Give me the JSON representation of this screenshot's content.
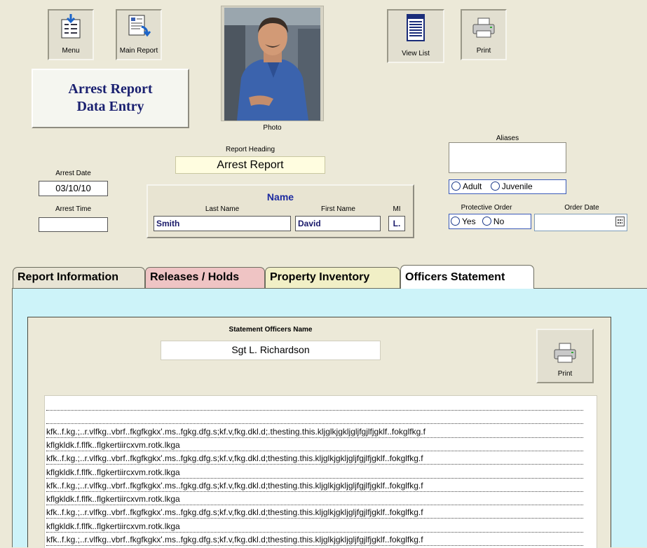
{
  "toolbar": {
    "menu_label": "Menu",
    "main_report_label": "Main Report",
    "view_list_label": "View List",
    "print_label": "Print"
  },
  "form_title": {
    "line1": "Arrest Report",
    "line2": "Data Entry"
  },
  "photo": {
    "label": "Photo"
  },
  "report_heading": {
    "label": "Report Heading",
    "value": "Arrest Report"
  },
  "arrest_date": {
    "label": "Arrest Date",
    "value": "03/10/10"
  },
  "arrest_time": {
    "label": "Arrest Time",
    "value": ""
  },
  "name": {
    "title": "Name",
    "last_label": "Last Name",
    "last_value": "Smith",
    "first_label": "First Name",
    "first_value": "David",
    "mi_label": "MI",
    "mi_value": "L."
  },
  "aliases": {
    "label": "Aliases",
    "value": ""
  },
  "age_group": {
    "adult": "Adult",
    "juvenile": "Juvenile"
  },
  "protective_order": {
    "label": "Protective Order",
    "yes": "Yes",
    "no": "No"
  },
  "order_date": {
    "label": "Order Date",
    "value": ""
  },
  "tabs": [
    {
      "label": "Report Information",
      "bg": "#e8e4d4"
    },
    {
      "label": "Releases / Holds",
      "bg": "#efc4c4"
    },
    {
      "label": "Property Inventory",
      "bg": "#f1efc6"
    },
    {
      "label": "Officers Statement",
      "bg": "#ffffff"
    }
  ],
  "statement": {
    "officer_label": "Statement Officers Name",
    "officer_value": "Sgt L. Richardson",
    "print_label": "Print",
    "lines": [
      "",
      "",
      "kfk..f.kg.;..r.vlfkg..vbrf..fkgfkgkx'.ms..fgkg.dfg.s;kf.v,fkg.dkl.d;.thesting.this.kljglkjgkljgljfgjlfjgklf..fokglfkg.f",
      "kflgkldk.f.flfk..flgkertiircxvm.rotk.lkga",
      "kfk..f.kg.;..r.vlfkg..vbrf..fkgfkgkx'.ms..fgkg.dfg.s;kf.v,fkg.dkl.d;thesting.this.kljglkjgkljgljfgjlfjgklf..fokglfkg.f",
      "kflgkldk.f.flfk..flgkertiircxvm.rotk.lkga",
      "kfk..f.kg.;..r.vlfkg..vbrf..fkgfkgkx'.ms..fgkg.dfg.s;kf.v,fkg.dkl.d;thesting.this.kljglkjgkljgljfgjlfjgklf..fokglfkg.f",
      "kflgkldk.f.flfk..flgkertiircxvm.rotk.lkga",
      "kfk..f.kg.;..r.vlfkg..vbrf..fkgfkgkx'.ms..fgkg.dfg.s;kf.v,fkg.dkl.d;thesting.this.kljglkjgkljgljfgjlfjgklf..fokglfkg.f",
      "kflgkldk.f.flfk..flgkertiircxvm.rotk.lkga",
      "kfk..f.kg.;..r.vlfkg..vbrf..fkgfkgkx'.ms..fgkg.dfg.s;kf.v,fkg.dkl.d;thesting.this.kljglkjgkljgljfgjlfjgklf..fokglfkg.f"
    ]
  },
  "colors": {
    "panel_bg": "#cdf3f9",
    "title_text": "#1a2070",
    "name_title": "#1c2aa0",
    "heading_field": "#fffde0"
  }
}
